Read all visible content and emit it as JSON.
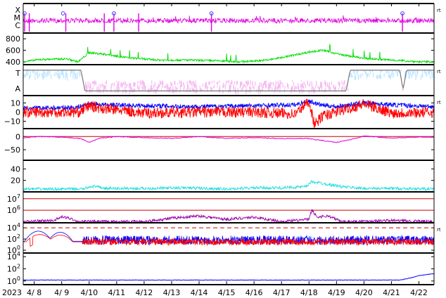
{
  "chart_data": {
    "type": "line",
    "x_axis": {
      "year_label": "2023",
      "tick_labels": [
        "4/ 8",
        "4/ 9",
        "4/10",
        "4/11",
        "4/12",
        "4/13",
        "4/14",
        "4/15",
        "4/16",
        "4/17",
        "4/18",
        "4/19",
        "4/20",
        "4/21",
        "4/22"
      ],
      "range_days": [
        7.6,
        22.55
      ]
    },
    "panels": [
      {
        "id": "xmc",
        "ylabels": [
          "X",
          "M",
          "C"
        ],
        "right_marker": "rt",
        "series": [
          {
            "color": "#e000e0",
            "kind": "flux",
            "base": 0.58,
            "noise": 0.08
          }
        ],
        "flare_markers": [
          7.65,
          9.05,
          10.9,
          14.45,
          21.4
        ],
        "flare_marker_color": "#3a3aff",
        "spikes": [
          7.65,
          7.82,
          9.15,
          10.55,
          10.9,
          11.8,
          14.45,
          21.4
        ]
      },
      {
        "id": "speed",
        "yticks": [
          {
            "v": 800,
            "label": "800"
          },
          {
            "v": 600,
            "label": "600"
          },
          {
            "v": 400,
            "label": "400"
          }
        ],
        "ylim": [
          350,
          900
        ],
        "series": [
          {
            "color": "#00dd00",
            "profile": [
              [
                7.6,
                400
              ],
              [
                8.2,
                440
              ],
              [
                9.2,
                450
              ],
              [
                9.6,
                400
              ],
              [
                10.0,
                560
              ],
              [
                10.6,
                530
              ],
              [
                11.4,
                470
              ],
              [
                12.5,
                430
              ],
              [
                13.5,
                430
              ],
              [
                14.5,
                420
              ],
              [
                15.5,
                400
              ],
              [
                16.5,
                430
              ],
              [
                17.5,
                520
              ],
              [
                18.0,
                570
              ],
              [
                18.5,
                600
              ],
              [
                19.2,
                520
              ],
              [
                20.0,
                460
              ],
              [
                21.0,
                430
              ],
              [
                22.0,
                400
              ],
              [
                22.55,
                400
              ]
            ]
          }
        ]
      },
      {
        "id": "polarity",
        "ylabels": [
          "T",
          "A"
        ],
        "right_marker": "rt",
        "series": [
          {
            "color": "#bfe6ff",
            "name": "T"
          },
          {
            "color": "#f5b8f0",
            "name": "A"
          },
          {
            "color": "#777777",
            "name": "sector"
          }
        ],
        "sector_profile": [
          [
            7.6,
            0.82
          ],
          [
            9.7,
            0.82
          ],
          [
            9.85,
            0.15
          ],
          [
            19.35,
            0.15
          ],
          [
            19.5,
            0.82
          ],
          [
            21.3,
            0.82
          ],
          [
            21.42,
            0.2
          ],
          [
            21.55,
            0.82
          ],
          [
            22.55,
            0.82
          ]
        ]
      },
      {
        "id": "bfield",
        "yticks": [
          {
            "v": 10,
            "label": "10"
          },
          {
            "v": 0,
            "label": "0"
          },
          {
            "v": -10,
            "label": "−10"
          }
        ],
        "ylim": [
          -18,
          18
        ],
        "right_marker": "rt",
        "series": [
          {
            "color": "#0000ff",
            "name": "Bt",
            "profile": [
              [
                7.6,
                4
              ],
              [
                9.5,
                5
              ],
              [
                10.0,
                9
              ],
              [
                10.5,
                8
              ],
              [
                12,
                7
              ],
              [
                14,
                6
              ],
              [
                16,
                7
              ],
              [
                17.5,
                8
              ],
              [
                18.0,
                12
              ],
              [
                18.4,
                8
              ],
              [
                19,
                6
              ],
              [
                20,
                10
              ],
              [
                21,
                8
              ],
              [
                22.55,
                6
              ]
            ]
          },
          {
            "color": "#ff0000",
            "name": "Bz",
            "profile": [
              [
                7.6,
                0
              ],
              [
                9.6,
                0
              ],
              [
                10.0,
                7
              ],
              [
                10.5,
                4
              ],
              [
                12,
                -1
              ],
              [
                14,
                0
              ],
              [
                16,
                0
              ],
              [
                17.5,
                -2
              ],
              [
                18.0,
                12
              ],
              [
                18.2,
                -14
              ],
              [
                18.5,
                -4
              ],
              [
                19,
                0
              ],
              [
                20,
                9
              ],
              [
                21,
                -1
              ],
              [
                22.55,
                0
              ]
            ]
          }
        ]
      },
      {
        "id": "dst",
        "yticks": [
          {
            "v": 0,
            "label": "0"
          },
          {
            "v": -50,
            "label": "−50"
          }
        ],
        "ylim": [
          -90,
          30
        ],
        "zero_line_color": "#cc0000",
        "series": [
          {
            "color": "#dd00dd",
            "profile": [
              [
                7.6,
                -5
              ],
              [
                8.2,
                0
              ],
              [
                9.0,
                -2
              ],
              [
                9.7,
                -8
              ],
              [
                10.0,
                -22
              ],
              [
                10.4,
                -6
              ],
              [
                11,
                0
              ],
              [
                12,
                -4
              ],
              [
                13,
                -7
              ],
              [
                14,
                0
              ],
              [
                15,
                -7
              ],
              [
                16,
                -4
              ],
              [
                17,
                -8
              ],
              [
                18,
                -8
              ],
              [
                18.4,
                -14
              ],
              [
                19.0,
                -22
              ],
              [
                19.5,
                -12
              ],
              [
                20,
                2
              ],
              [
                21,
                -6
              ],
              [
                22,
                -2
              ],
              [
                22.55,
                -3
              ]
            ]
          }
        ]
      },
      {
        "id": "kp",
        "yticks": [
          {
            "v": 40,
            "label": "40"
          },
          {
            "v": 20,
            "label": "20"
          }
        ],
        "ylim": [
          0,
          55
        ],
        "series": [
          {
            "color": "#22dddd",
            "profile": [
              [
                7.6,
                5
              ],
              [
                9.8,
                5
              ],
              [
                10.1,
                10
              ],
              [
                10.6,
                6
              ],
              [
                12,
                6
              ],
              [
                13.5,
                7
              ],
              [
                15,
                5
              ],
              [
                16,
                7
              ],
              [
                17,
                7
              ],
              [
                17.9,
                9
              ],
              [
                18.1,
                18
              ],
              [
                18.6,
                14
              ],
              [
                19.2,
                9
              ],
              [
                20,
                6
              ],
              [
                21,
                6
              ],
              [
                22.55,
                5
              ]
            ]
          }
        ]
      },
      {
        "id": "electron",
        "yticks": [
          {
            "e": 7,
            "label": "10^7"
          },
          {
            "e": 6,
            "label": "10^6"
          }
        ],
        "ylim_exp": [
          4.9,
          7.6
        ],
        "threshold_color": "#cc0000",
        "series": [
          {
            "color": "#9900aa",
            "profile": [
              [
                7.6,
                5.0
              ],
              [
                8.7,
                5.1
              ],
              [
                9.0,
                5.4
              ],
              [
                9.3,
                5.3
              ],
              [
                9.6,
                5.0
              ],
              [
                12,
                5.0
              ],
              [
                13.0,
                5.3
              ],
              [
                14.0,
                5.5
              ],
              [
                15,
                5.2
              ],
              [
                16,
                5.4
              ],
              [
                17,
                5.0
              ],
              [
                18.0,
                5.2
              ],
              [
                18.1,
                6.0
              ],
              [
                18.3,
                5.4
              ],
              [
                18.7,
                5.5
              ],
              [
                19.2,
                5.0
              ],
              [
                21,
                5.1
              ],
              [
                22.55,
                5.0
              ]
            ]
          }
        ]
      },
      {
        "id": "proton",
        "yticks": [
          {
            "e": 4,
            "label": "10^4"
          },
          {
            "e": 2,
            "label": "10^2"
          },
          {
            "e": 0,
            "label": "10^0"
          }
        ],
        "ylim_exp": [
          -0.5,
          4.9
        ],
        "right_marker": "rt",
        "threshold_color": "#cc0000",
        "series": [
          {
            "color": "#0000ff",
            "name": "high"
          },
          {
            "color": "#ff0000",
            "name": "low"
          }
        ]
      },
      {
        "id": "bottom",
        "yticks": [
          {
            "e": 4,
            "label": "10^4"
          },
          {
            "e": 2,
            "label": "10^2"
          },
          {
            "e": 0,
            "label": "10^0"
          }
        ],
        "ylim_exp": [
          -0.6,
          4.6
        ],
        "series": [
          {
            "color": "#0000ff",
            "profile": [
              [
                7.6,
                0.15
              ],
              [
                21.3,
                0.15
              ],
              [
                21.7,
                0.5
              ],
              [
                22.0,
                0.9
              ],
              [
                22.55,
                1.2
              ]
            ]
          }
        ]
      }
    ]
  }
}
